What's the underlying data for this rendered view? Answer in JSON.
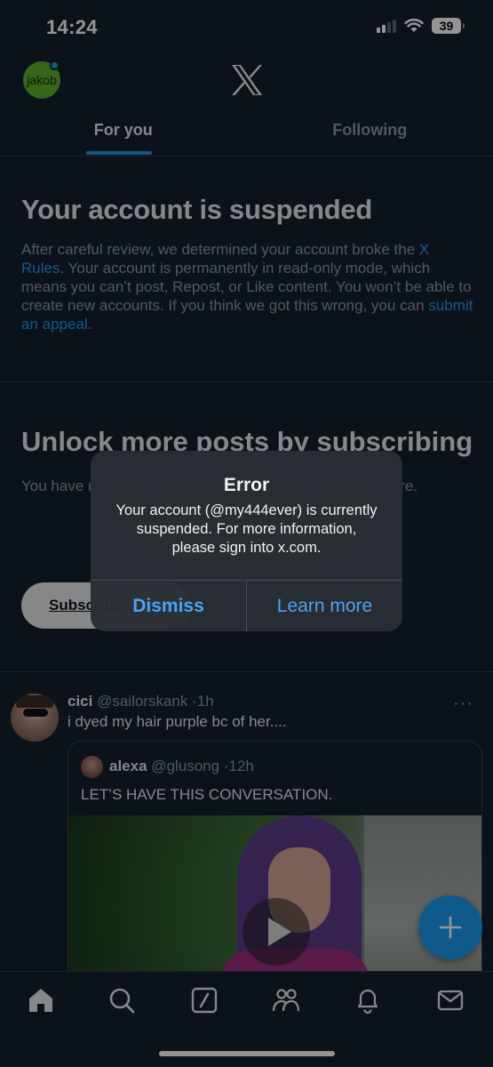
{
  "status_bar": {
    "time": "14:24",
    "battery": "39"
  },
  "header": {
    "avatar_text": "jakob",
    "logo_icon": "x-logo-icon"
  },
  "tabs": [
    {
      "label": "For you",
      "active": true
    },
    {
      "label": "Following",
      "active": false
    }
  ],
  "suspension_notice": {
    "title": "Your account is suspended",
    "body_part1": "After careful review, we determined your account broke the ",
    "link_rules": "X Rules",
    "body_part2": ". Your account is permanently in read-only mode, which means you can’t post, Repost, or Like content. You won’t be able to create new accounts. If you think we got this wrong, you can ",
    "link_appeal": "submit an appeal",
    "body_part3": "."
  },
  "unlock": {
    "title": "Unlock more posts by subscribing",
    "body": "You have run out of posts for today. Subscribe to see more.",
    "button_label": "Subscribe"
  },
  "tweet": {
    "name": "cici",
    "handle": "@sailorskank",
    "time": "1h",
    "text": "i dyed my hair purple bc of her....",
    "more_icon": "more-icon",
    "quote": {
      "name": "alexa",
      "handle": "@glusong",
      "time": "12h",
      "text": "LET’S HAVE THIS CONVERSATION."
    }
  },
  "alert": {
    "title": "Error",
    "message": "Your account (@my444ever) is currently suspended. For more information, please sign into x.com.",
    "dismiss_label": "Dismiss",
    "learn_more_label": "Learn more"
  },
  "colors": {
    "background": "#15202b",
    "accent": "#1d9bf0",
    "alert_button": "#4da3f7"
  }
}
